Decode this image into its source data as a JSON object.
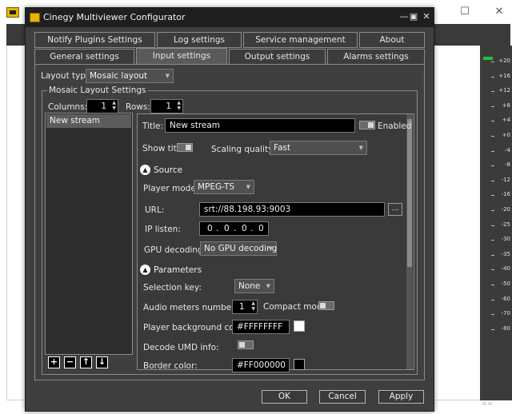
{
  "background_window": {
    "minimize_glyph": "—",
    "maximize_glyph": "☐",
    "close_glyph": "✕",
    "meter_ticks": [
      "+20",
      "+16",
      "+12",
      "+8",
      "+4",
      "+0",
      "-4",
      "-8",
      "-12",
      "-16",
      "-20",
      "-25",
      "-30",
      "-35",
      "-40",
      "-50",
      "-60",
      "-70",
      "-80"
    ],
    "meter_color": "#2bbf3a"
  },
  "dialog": {
    "title": "Cinegy Multiviewer Configurator",
    "minimize_glyph": "—",
    "maximize_glyph": "▣",
    "close_glyph": "✕"
  },
  "tabs": {
    "row1": [
      "Notify Plugins Settings",
      "Log settings",
      "Service management",
      "About"
    ],
    "row2": [
      "General settings",
      "Input settings",
      "Output settings",
      "Alarms settings"
    ],
    "active": "Input settings"
  },
  "layout": {
    "type_label": "Layout type:",
    "type_value": "Mosaic layout",
    "group_title": "Mosaic Layout Settings",
    "columns_label": "Columns:",
    "columns_value": "1",
    "rows_label": "Rows:",
    "rows_value": "1"
  },
  "streams": {
    "items": [
      "New stream"
    ],
    "buttons": [
      "+",
      "−",
      "↑",
      "↓"
    ]
  },
  "stream_props": {
    "title_label": "Title:",
    "title_value": "New stream",
    "enabled_label": "Enabled",
    "show_title_label": "Show title",
    "scaling_label": "Scaling quality:",
    "scaling_value": "Fast",
    "source_section": "Source",
    "player_mode_label": "Player mode:",
    "player_mode_value": "MPEG-TS",
    "url_label": "URL:",
    "url_value": "srt://88.198.93:9003",
    "browse_label": "...",
    "ip_listen_label": "IP listen:",
    "ip_listen_octets": [
      "0",
      "0",
      "0",
      "0"
    ],
    "gpu_label": "GPU decoding:",
    "gpu_value": "No GPU decoding",
    "parameters_section": "Parameters",
    "selection_key_label": "Selection key:",
    "selection_key_value": "None",
    "audio_meters_label": "Audio meters number:",
    "audio_meters_value": "1",
    "compact_mode_label": "Compact mode",
    "bg_color_label": "Player background color:",
    "bg_color_value": "#FFFFFFFF",
    "bg_color_swatch": "#ffffff",
    "decode_umd_label": "Decode UMD info:",
    "border_color_label": "Border color:",
    "border_color_value": "#FF000000",
    "border_color_swatch": "#000000"
  },
  "footer": {
    "ok": "OK",
    "cancel": "Cancel",
    "apply": "Apply"
  }
}
